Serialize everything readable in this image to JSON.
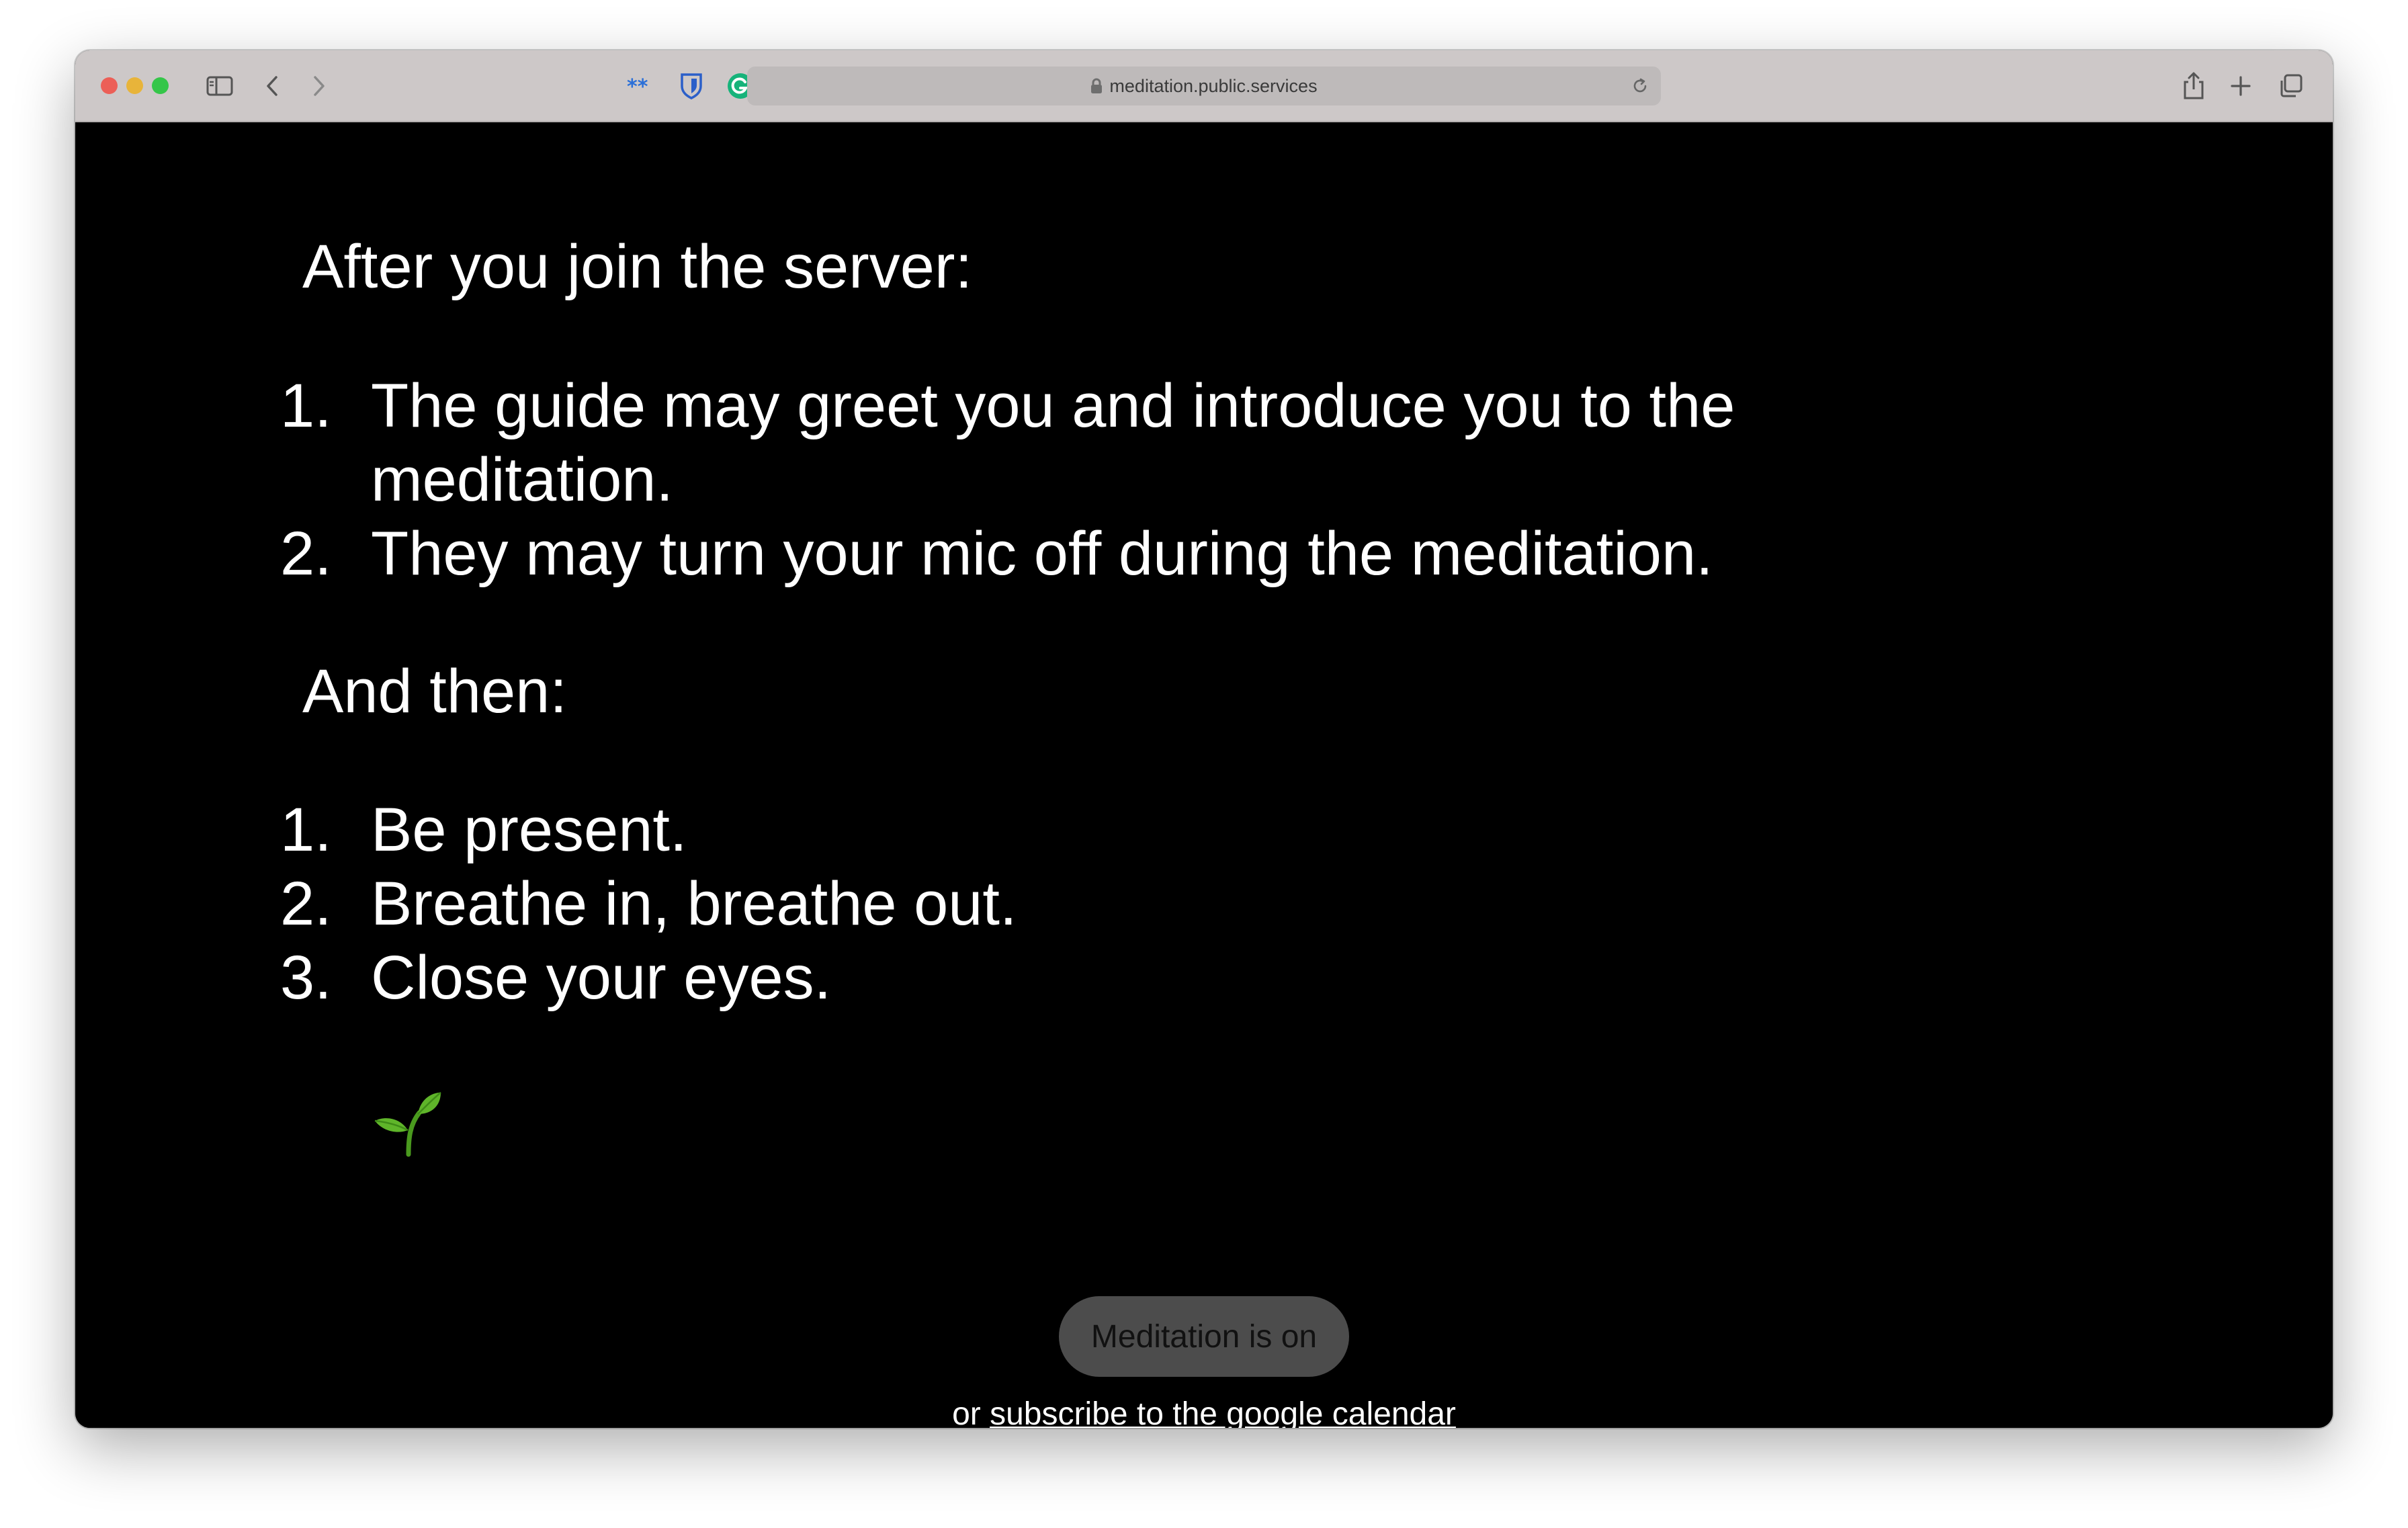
{
  "browser": {
    "url": "meditation.public.services",
    "colors": {
      "toolbar": "#cdc8c8",
      "close": "#ec5f57",
      "minimize": "#e8b43a",
      "zoom": "#35c649"
    },
    "toolbar_icons": [
      "sidebar-icon",
      "back-icon",
      "forward-icon",
      "asterisk-extension-icon",
      "bitwarden-icon",
      "grammarly-icon",
      "privacy-shield-icon",
      "lock-icon",
      "reload-icon",
      "share-icon",
      "new-tab-icon",
      "tab-overview-icon"
    ]
  },
  "page": {
    "section1_heading": "After you join the server:",
    "section1_items": [
      {
        "num": "1.",
        "line1": "The guide may greet you and introduce you to the",
        "line2": "meditation."
      },
      {
        "num": "2.",
        "line1": "They may turn your mic off during the meditation."
      }
    ],
    "section2_heading": "And then:",
    "section2_items": [
      {
        "num": "1.",
        "text": "Be present."
      },
      {
        "num": "2.",
        "text": "Breathe in, breathe out."
      },
      {
        "num": "3.",
        "text": "Close your eyes."
      }
    ],
    "sprout_icon": "seedling-icon",
    "status_button": "Meditation is on",
    "footer_prefix": "or ",
    "footer_link": "subscribe to the google calendar"
  }
}
